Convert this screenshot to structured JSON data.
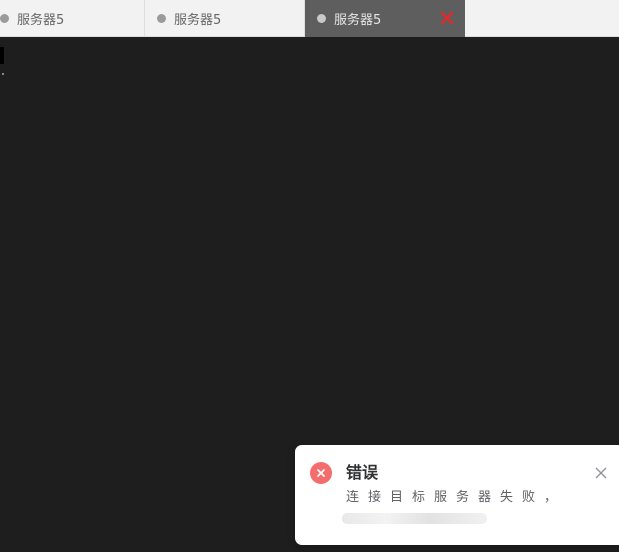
{
  "tabs": [
    {
      "label": "服务器5",
      "active": false
    },
    {
      "label": "服务器5",
      "active": false
    },
    {
      "label": "服务器5",
      "active": true
    }
  ],
  "colors": {
    "terminal_bg": "#1e1e1e",
    "active_tab_bg": "#5e5e5e",
    "close_red": "#e02b2b",
    "error_red": "#f56c6c"
  },
  "notification": {
    "type": "error",
    "title": "错误",
    "message": "连接目标服务器失败，"
  }
}
